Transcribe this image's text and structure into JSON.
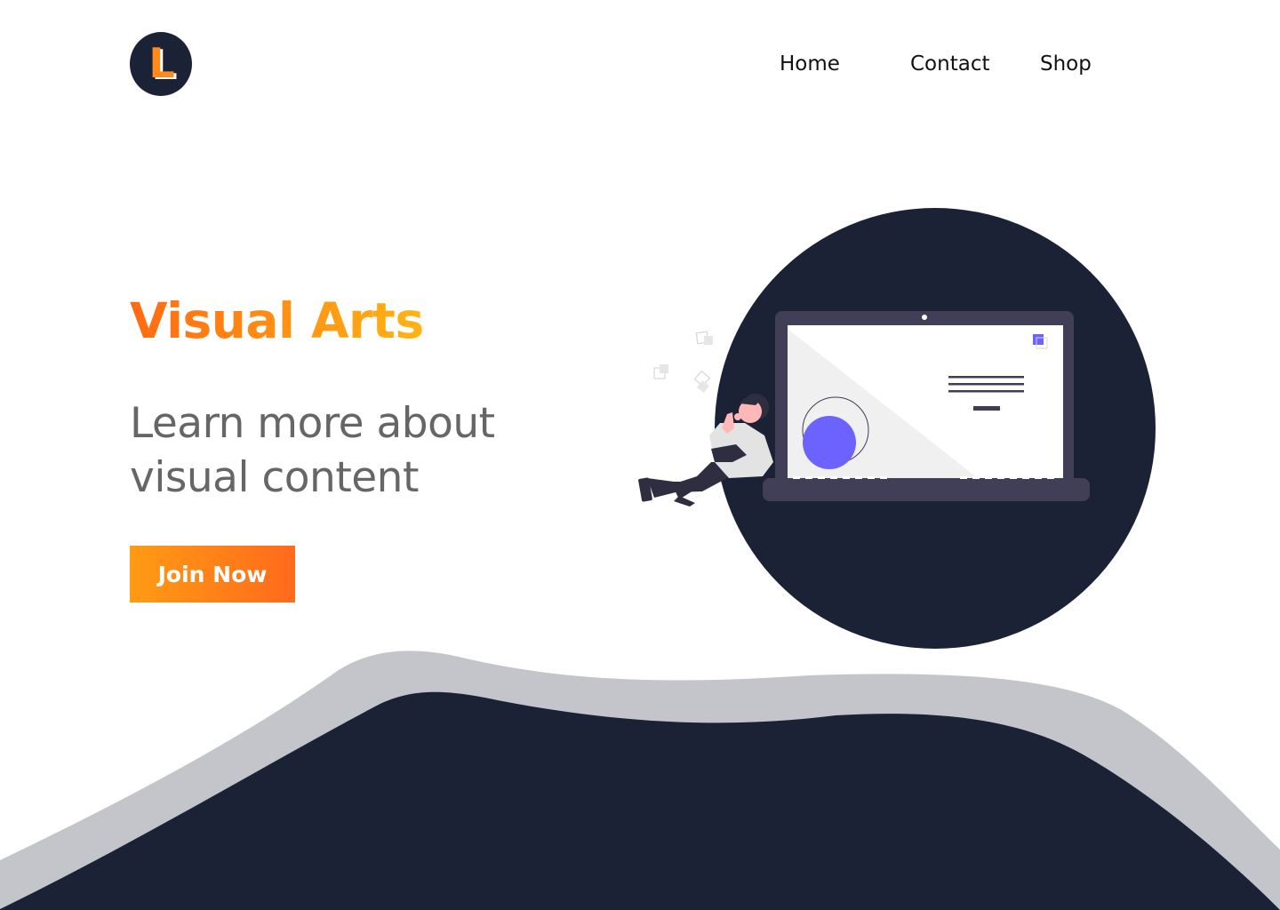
{
  "header": {
    "logo_letter": "L",
    "nav": [
      {
        "label": "Home"
      },
      {
        "label": "Contact"
      },
      {
        "label": "Shop"
      }
    ]
  },
  "hero": {
    "title": "Visual Arts",
    "subtitle": "Learn more about visual content",
    "cta_label": "Join Now"
  },
  "colors": {
    "navy": "#1b2236",
    "orange_start": "#ff6a13",
    "orange_end": "#ffb414",
    "accent_purple": "#6c63ff",
    "wave_gray": "#c4c5ca",
    "subtitle_gray": "#666666"
  },
  "icons": {
    "logo": "letter-l-logo",
    "illustration": "person-leaning-on-laptop"
  }
}
